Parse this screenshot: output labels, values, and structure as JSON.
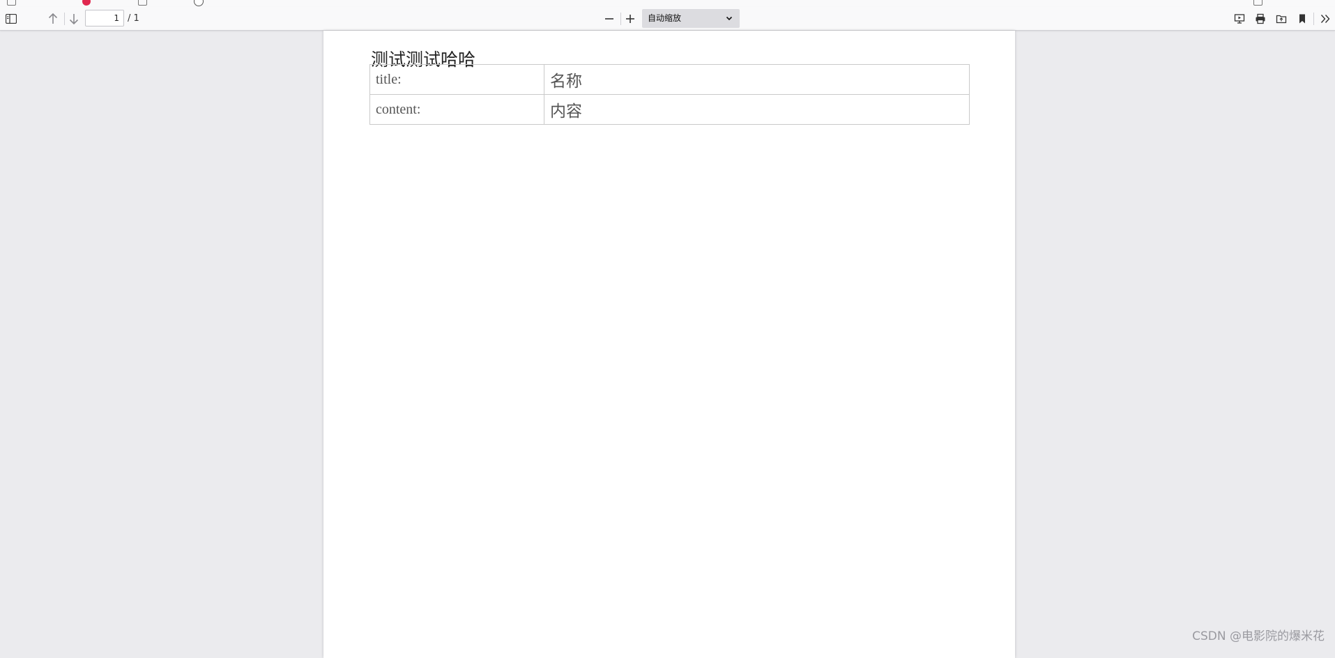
{
  "toolbar": {
    "page_number": "1",
    "page_total": "/ 1",
    "zoom_value": "自动缩放",
    "icons": [
      "sidebar-toggle-icon",
      "arrow-up-icon",
      "arrow-down-icon",
      "zoom-out-icon",
      "zoom-in-icon",
      "chevron-down-icon",
      "presentation-icon",
      "print-icon",
      "open-file-icon",
      "bookmark-icon",
      "double-chevron-right-icon"
    ]
  },
  "document": {
    "heading": "测试测试哈哈",
    "rows": [
      {
        "key": "title:",
        "value": "名称"
      },
      {
        "key": "content:",
        "value": "内容"
      }
    ]
  },
  "watermark": "CSDN @电影院的爆米花",
  "colors": {
    "toolbar_bg": "#f9f9fa",
    "viewer_bg": "#ebebee",
    "page_bg": "#ffffff",
    "zoom_select_bg": "#dcdce0"
  }
}
